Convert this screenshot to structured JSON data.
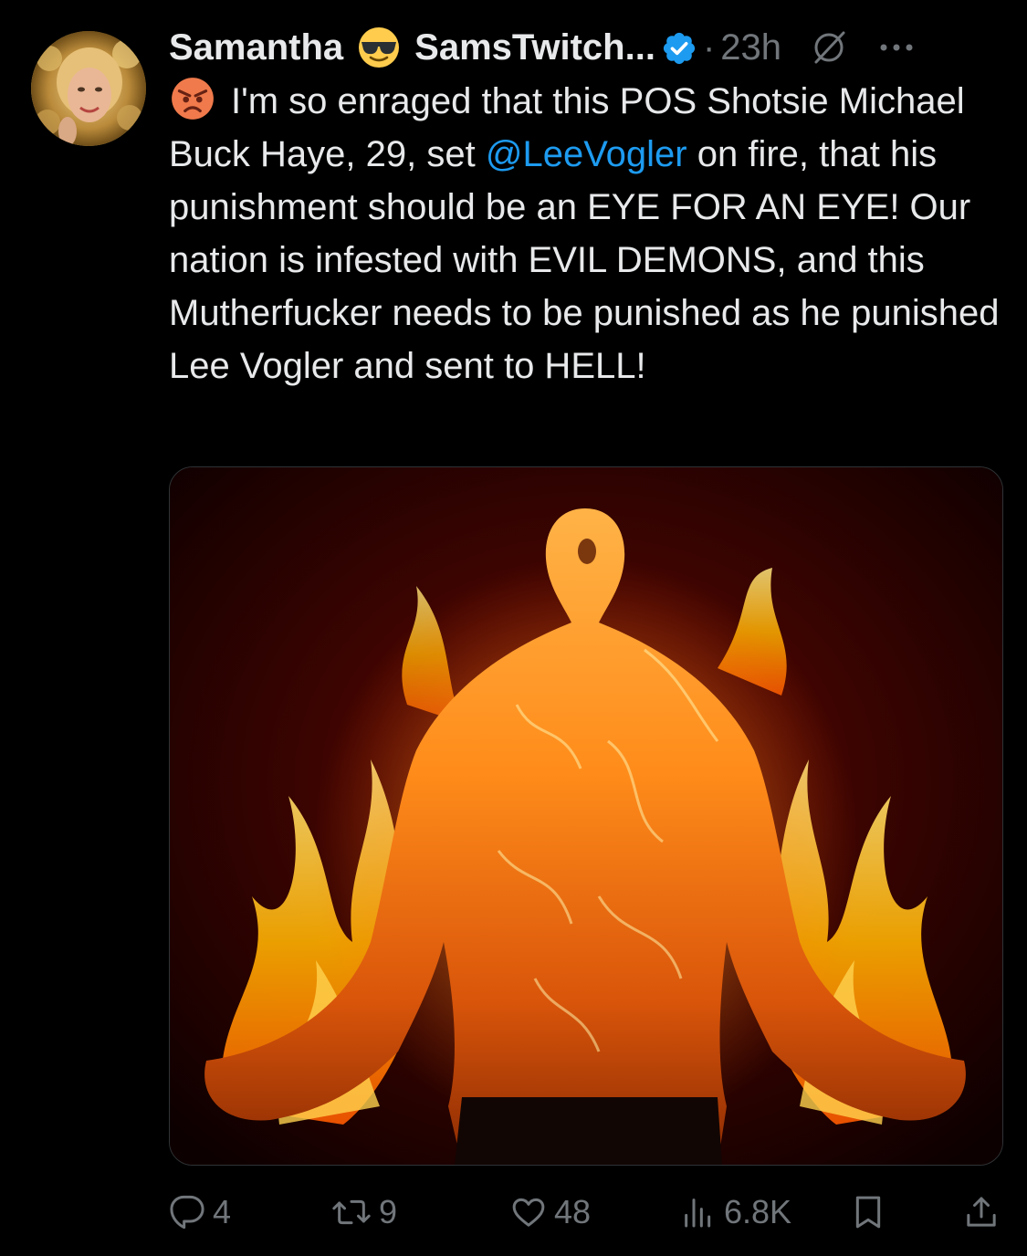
{
  "tweet": {
    "display_name": "Samantha",
    "display_emoji": "smiling-face-with-sunglasses",
    "handle_truncated": "SamsTwitch...",
    "separator": "·",
    "time": "23h",
    "text_emoji": "pouting-face",
    "text_before_mention": "I'm so enraged that this POS Shotsie Michael Buck Haye, 29, set ",
    "mention": "@LeeVogler",
    "text_after_mention": " on fire, that his punishment should be an EYE FOR AN EYE! Our nation is infested with EVIL DEMONS, and this Mutherfucker needs to be punished as he punished Lee Vogler and sent to HELL!"
  },
  "actions": {
    "replies": "4",
    "reposts": "9",
    "likes": "48",
    "views": "6.8K"
  },
  "colors": {
    "background": "#000000",
    "text": "#e7e9ea",
    "muted": "#71767b",
    "accent": "#1d9bf0",
    "border": "#2f3336"
  },
  "icons": {
    "verified": "verified-badge-icon",
    "grok": "grok-icon",
    "more": "more-icon",
    "reply": "reply-icon",
    "repost": "repost-icon",
    "like": "like-icon",
    "views": "views-icon",
    "bookmark": "bookmark-icon",
    "share": "share-icon"
  }
}
